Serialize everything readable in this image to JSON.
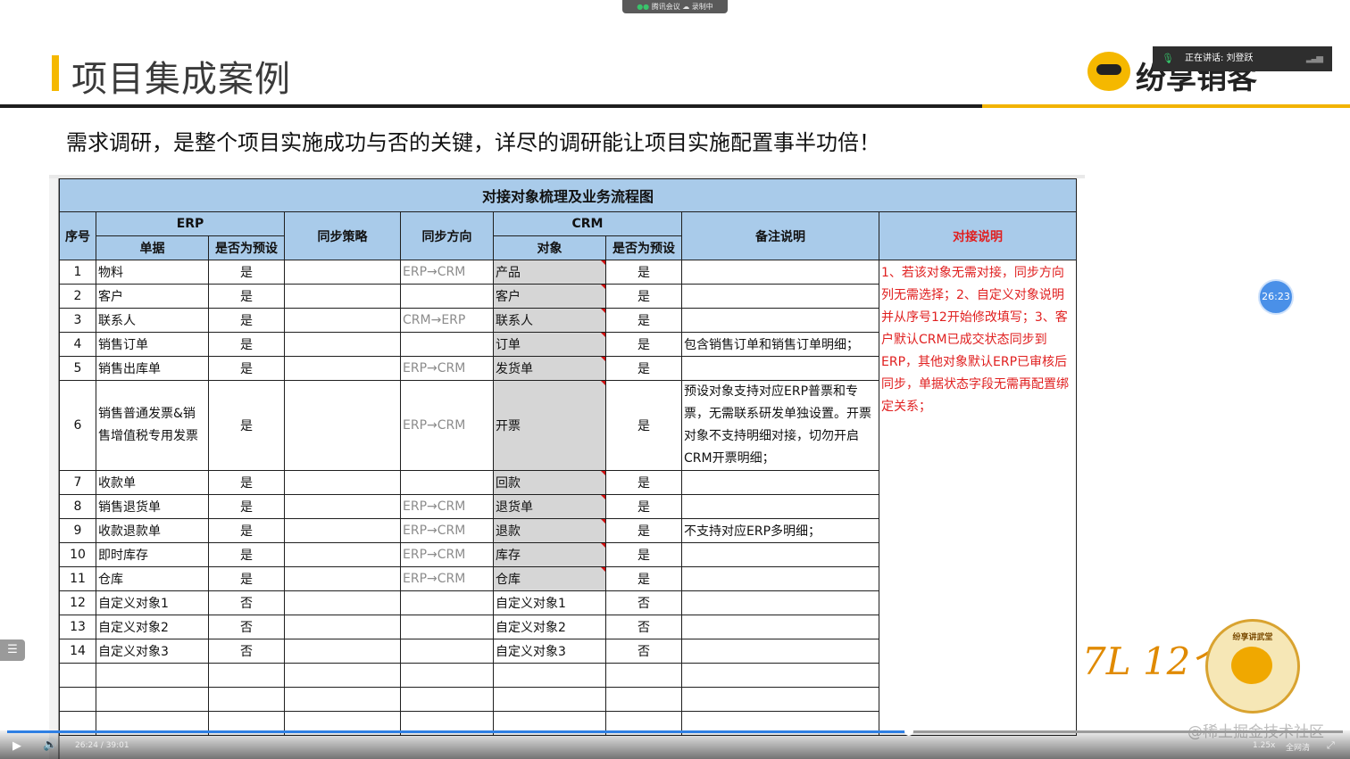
{
  "meeting_bar": {
    "app": "腾讯会议",
    "recording": "录制中"
  },
  "slide": {
    "title": "项目集成案例",
    "subtitle": "需求调研，是整个项目实施成功与否的关键，详尽的调研能让项目实施配置事半功倍！",
    "brand": "纷享销客"
  },
  "speaker": {
    "label": "正在讲话: 刘登跃"
  },
  "table": {
    "title": "对接对象梳理及业务流程图",
    "headers": {
      "seq": "序号",
      "erp": "ERP",
      "erp_doc": "单据",
      "erp_preset": "是否为预设",
      "sync_strategy": "同步策略",
      "sync_direction": "同步方向",
      "crm": "CRM",
      "crm_obj": "对象",
      "crm_preset": "是否为预设",
      "remarks": "备注说明",
      "notes": "对接说明"
    },
    "rows": [
      {
        "seq": "1",
        "erp_doc": "物料",
        "erp_preset": "是",
        "strategy": "",
        "direction": "ERP→CRM",
        "crm_obj": "产品",
        "crm_preset": "是",
        "remark": ""
      },
      {
        "seq": "2",
        "erp_doc": "客户",
        "erp_preset": "是",
        "strategy": "",
        "direction": "",
        "crm_obj": "客户",
        "crm_preset": "是",
        "remark": ""
      },
      {
        "seq": "3",
        "erp_doc": "联系人",
        "erp_preset": "是",
        "strategy": "",
        "direction": "CRM→ERP",
        "crm_obj": "联系人",
        "crm_preset": "是",
        "remark": ""
      },
      {
        "seq": "4",
        "erp_doc": "销售订单",
        "erp_preset": "是",
        "strategy": "",
        "direction": "",
        "crm_obj": "订单",
        "crm_preset": "是",
        "remark": "包含销售订单和销售订单明细；"
      },
      {
        "seq": "5",
        "erp_doc": "销售出库单",
        "erp_preset": "是",
        "strategy": "",
        "direction": "ERP→CRM",
        "crm_obj": "发货单",
        "crm_preset": "是",
        "remark": ""
      },
      {
        "seq": "6",
        "erp_doc": "销售普通发票&销售增值税专用发票",
        "erp_preset": "是",
        "strategy": "",
        "direction": "ERP→CRM",
        "crm_obj": "开票",
        "crm_preset": "是",
        "remark": "预设对象支持对应ERP普票和专票，无需联系研发单独设置。开票对象不支持明细对接，切勿开启CRM开票明细；"
      },
      {
        "seq": "7",
        "erp_doc": "收款单",
        "erp_preset": "是",
        "strategy": "",
        "direction": "",
        "crm_obj": "回款",
        "crm_preset": "是",
        "remark": ""
      },
      {
        "seq": "8",
        "erp_doc": "销售退货单",
        "erp_preset": "是",
        "strategy": "",
        "direction": "ERP→CRM",
        "crm_obj": "退货单",
        "crm_preset": "是",
        "remark": ""
      },
      {
        "seq": "9",
        "erp_doc": "收款退款单",
        "erp_preset": "是",
        "strategy": "",
        "direction": "ERP→CRM",
        "crm_obj": "退款",
        "crm_preset": "是",
        "remark": "不支持对应ERP多明细；"
      },
      {
        "seq": "10",
        "erp_doc": "即时库存",
        "erp_preset": "是",
        "strategy": "",
        "direction": "ERP→CRM",
        "crm_obj": "库存",
        "crm_preset": "是",
        "remark": ""
      },
      {
        "seq": "11",
        "erp_doc": "仓库",
        "erp_preset": "是",
        "strategy": "",
        "direction": "ERP→CRM",
        "crm_obj": "仓库",
        "crm_preset": "是",
        "remark": ""
      },
      {
        "seq": "12",
        "erp_doc": "自定义对象1",
        "erp_preset": "否",
        "strategy": "",
        "direction": "",
        "crm_obj": "自定义对象1",
        "crm_preset": "否",
        "remark": ""
      },
      {
        "seq": "13",
        "erp_doc": "自定义对象2",
        "erp_preset": "否",
        "strategy": "",
        "direction": "",
        "crm_obj": "自定义对象2",
        "crm_preset": "否",
        "remark": ""
      },
      {
        "seq": "14",
        "erp_doc": "自定义对象3",
        "erp_preset": "否",
        "strategy": "",
        "direction": "",
        "crm_obj": "自定义对象3",
        "crm_preset": "否",
        "remark": ""
      }
    ],
    "notes": "1、若该对象无需对接，同步方向列无需选择；2、自定义对象说明并从序号12开始修改填写；3、客户默认CRM已成交状态同步到ERP，其他对象默认ERP已审核后同步，单据状态字段无需再配置绑定关系；"
  },
  "timer_badge": "26:23",
  "decor": {
    "text": "7L 12个月",
    "seal_text": "纷享讲武堂"
  },
  "watermark": "@稀土掘金技术社区",
  "player": {
    "time": "26:24 / 39:01",
    "speed": "1.25x",
    "fullscreen": "全网清",
    "progress": 0.675
  },
  "colors": {
    "accent": "#f5b800",
    "header_bg": "#a9cbea",
    "note_red": "#e02020",
    "progress": "#2f7fe3"
  }
}
